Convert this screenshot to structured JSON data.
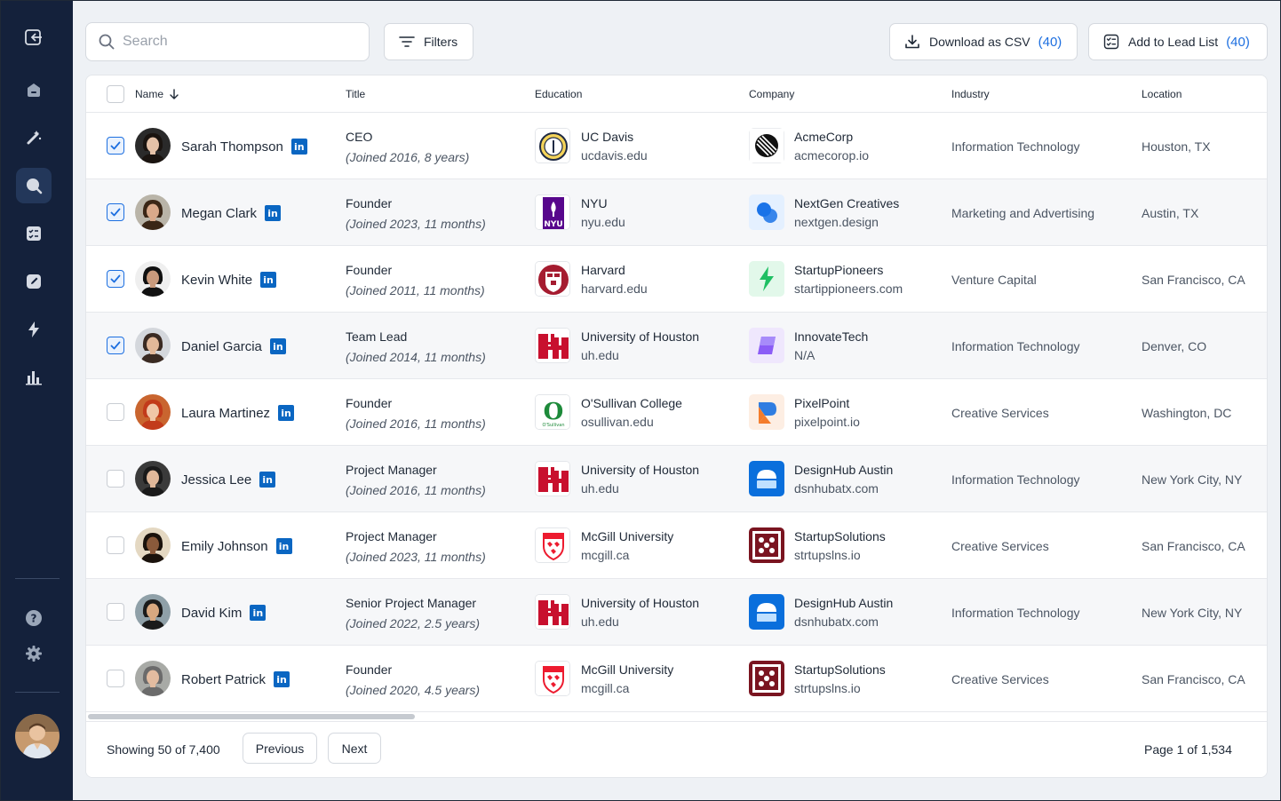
{
  "search": {
    "placeholder": "Search",
    "value": ""
  },
  "toolbar": {
    "filters_label": "Filters",
    "download_label": "Download as CSV",
    "download_count": "(40)",
    "lead_label": "Add to Lead List",
    "lead_count": "(40)"
  },
  "table": {
    "columns": [
      "Name",
      "Title",
      "Education",
      "Company",
      "Industry",
      "Location"
    ],
    "rows": [
      {
        "name": "Sarah Thompson",
        "checked": true,
        "title": "CEO",
        "tenure": "(Joined 2016, 8 years)",
        "school": "UC Davis",
        "school_domain": "ucdavis.edu",
        "school_logo": "ucdavis-seal",
        "company": "AcmeCorp",
        "company_domain": "acmecorop.io",
        "company_logo": "acmecorp",
        "industry": "Information Technology",
        "location": "Houston, TX"
      },
      {
        "name": "Megan Clark",
        "checked": true,
        "title": "Founder",
        "tenure": "(Joined 2023, 11 months)",
        "school": "NYU",
        "school_domain": "nyu.edu",
        "school_logo": "nyu",
        "company": "NextGen Creatives",
        "company_domain": "nextgen.design",
        "company_logo": "nextgen",
        "industry": "Marketing and Advertising",
        "location": "Austin, TX"
      },
      {
        "name": "Kevin White",
        "checked": true,
        "title": "Founder",
        "tenure": "(Joined 2011, 11 months)",
        "school": "Harvard",
        "school_domain": "harvard.edu",
        "school_logo": "harvard",
        "company": "StartupPioneers",
        "company_domain": "startippioneers.com",
        "company_logo": "startuppioneers",
        "industry": "Venture Capital",
        "location": "San Francisco, CA"
      },
      {
        "name": "Daniel Garcia",
        "checked": true,
        "title": "Team Lead",
        "tenure": "(Joined 2014, 11 months)",
        "school": "University of Houston",
        "school_domain": "uh.edu",
        "school_logo": "uh",
        "company": "InnovateTech",
        "company_domain": "N/A",
        "company_logo": "innovatetech",
        "industry": "Information Technology",
        "location": "Denver, CO"
      },
      {
        "name": "Laura Martinez",
        "checked": false,
        "title": "Founder",
        "tenure": "(Joined 2016, 11 months)",
        "school": "O'Sullivan College",
        "school_domain": "osullivan.edu",
        "school_logo": "osullivan",
        "company": "PixelPoint",
        "company_domain": "pixelpoint.io",
        "company_logo": "pixelpoint",
        "industry": "Creative Services",
        "location": "Washington, DC"
      },
      {
        "name": "Jessica Lee",
        "checked": false,
        "title": "Project Manager",
        "tenure": "(Joined 2016, 11 months)",
        "school": "University of Houston",
        "school_domain": "uh.edu",
        "school_logo": "uh",
        "company": "DesignHub Austin",
        "company_domain": "dsnhubatx.com",
        "company_logo": "designhub",
        "industry": "Information Technology",
        "location": "New York City, NY"
      },
      {
        "name": "Emily Johnson",
        "checked": false,
        "title": "Project Manager",
        "tenure": "(Joined 2023, 11 months)",
        "school": "McGill University",
        "school_domain": "mcgill.ca",
        "school_logo": "mcgill",
        "company": "StartupSolutions",
        "company_domain": "strtupslns.io",
        "company_logo": "startupsolutions",
        "industry": "Creative Services",
        "location": "San Francisco, CA"
      },
      {
        "name": "David Kim",
        "checked": false,
        "title": "Senior Project Manager",
        "tenure": "(Joined 2022, 2.5 years)",
        "school": "University of Houston",
        "school_domain": "uh.edu",
        "school_logo": "uh",
        "company": "DesignHub Austin",
        "company_domain": "dsnhubatx.com",
        "company_logo": "designhub",
        "industry": "Information Technology",
        "location": "New York City, NY"
      },
      {
        "name": "Robert Patrick",
        "checked": false,
        "title": "Founder",
        "tenure": "(Joined 2020, 4.5 years)",
        "school": "McGill University",
        "school_domain": "mcgill.ca",
        "school_logo": "mcgill",
        "company": "StartupSolutions",
        "company_domain": "strtupslns.io",
        "company_logo": "startupsolutions",
        "industry": "Creative Services",
        "location": "San Francisco, CA"
      }
    ]
  },
  "footer": {
    "showing": "Showing 50 of 7,400",
    "previous_label": "Previous",
    "next_label": "Next",
    "page_info": "Page 1 of 1,534"
  },
  "colors": {
    "sidebar": "#14213b",
    "accent": "#1d6fe0",
    "linkedin": "#0a66c2"
  }
}
